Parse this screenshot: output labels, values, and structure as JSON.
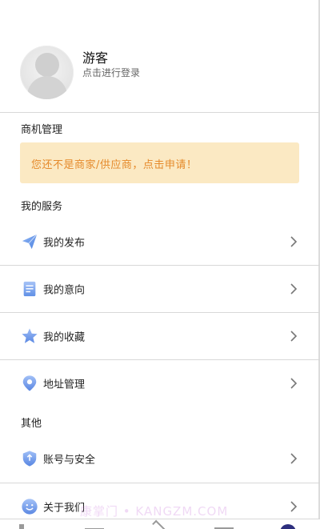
{
  "profile": {
    "name": "游客",
    "subtitle": "点击进行登录"
  },
  "business": {
    "title": "商机管理",
    "banner_text": "您还不是商家/供应商，点击申请！"
  },
  "services": {
    "title": "我的服务",
    "items": [
      {
        "label": "我的发布",
        "icon": "paper-plane-icon"
      },
      {
        "label": "我的意向",
        "icon": "document-icon"
      },
      {
        "label": "我的收藏",
        "icon": "star-icon"
      },
      {
        "label": "地址管理",
        "icon": "location-pin-icon"
      }
    ]
  },
  "other": {
    "title": "其他",
    "items": [
      {
        "label": "账号与安全",
        "icon": "shield-icon"
      },
      {
        "label": "关于我们",
        "icon": "smile-icon"
      }
    ]
  },
  "watermark": "康掌门 • KANGZM.COM",
  "colors": {
    "banner_bg": "#fbe9c3",
    "banner_text": "#e58a2b",
    "icon_blue": "#5b8fe8",
    "tab_active": "#2d2f7e"
  }
}
